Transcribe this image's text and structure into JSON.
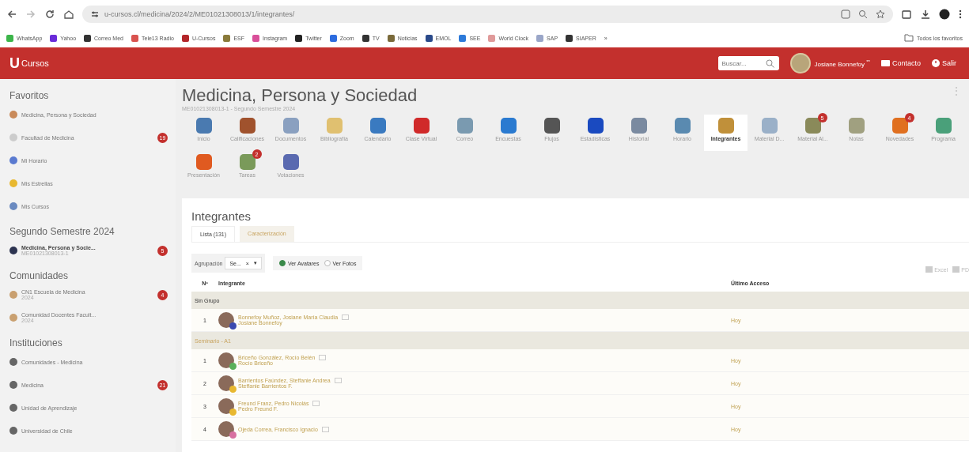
{
  "browser": {
    "url": "u-cursos.cl/medicina/2024/2/ME01021308013/1/integrantes/",
    "bookmarks": [
      {
        "label": "WhatsApp",
        "color": "#3cb54a"
      },
      {
        "label": "Yahoo",
        "color": "#6a2bd9"
      },
      {
        "label": "Correo Med",
        "color": "#333333"
      },
      {
        "label": "Tele13 Radio",
        "color": "#d9534f"
      },
      {
        "label": "U-Cursos",
        "color": "#b3262a"
      },
      {
        "label": "ESF",
        "color": "#8a7a3a"
      },
      {
        "label": "Instagram",
        "color": "#d94f9a"
      },
      {
        "label": "Twitter",
        "color": "#222222"
      },
      {
        "label": "Zoom",
        "color": "#2d6cdf"
      },
      {
        "label": "TV",
        "color": "#333333"
      },
      {
        "label": "Noticias",
        "color": "#7a6a3a"
      },
      {
        "label": "EMOL",
        "color": "#2a4a8a"
      },
      {
        "label": "SEE",
        "color": "#2d7ad9"
      },
      {
        "label": "World Clock",
        "color": "#e09a9a"
      },
      {
        "label": "SAP",
        "color": "#9aa6c8"
      },
      {
        "label": "SIAPER",
        "color": "#333333"
      }
    ],
    "more": "»",
    "all_bookmarks": "Todos los favoritos"
  },
  "header": {
    "logo_letter": "U",
    "logo_text": "Cursos",
    "search_placeholder": "Buscar...",
    "user": "Josiane Bonnefoy",
    "user_mark": "**",
    "contact": "Contacto",
    "logout": "Salir"
  },
  "sidebar": [
    {
      "title": "Favoritos",
      "items": [
        {
          "label": "Medicina, Persona y Sociedad",
          "color": "#c98a5a"
        },
        {
          "label": "Facultad de Medicina",
          "color": "#cccccc",
          "badge": "19"
        },
        {
          "label": "Mi Horario",
          "color": "#5a7ad0"
        },
        {
          "label": "Mis Estrellas",
          "color": "#e8b830"
        },
        {
          "label": "Mis Cursos",
          "color": "#6a8ac0"
        }
      ]
    },
    {
      "title": "Segundo Semestre 2024",
      "items": [
        {
          "label": "Medicina, Persona y Socie...",
          "sub": "ME01021308013-1",
          "color": "#2c3350",
          "badge": "5",
          "bold": true
        }
      ]
    },
    {
      "title": "Comunidades",
      "items": [
        {
          "label": "CN1 Escuela de Medicina",
          "sub": "2024",
          "color": "#c9a070",
          "badge": "4"
        },
        {
          "label": "Comunidad Docentes Facult...",
          "sub": "2024",
          "color": "#c9a070"
        }
      ]
    },
    {
      "title": "Instituciones",
      "items": [
        {
          "label": "Comunidades - Medicina",
          "color": "#666666"
        },
        {
          "label": "Medicina",
          "color": "#666666",
          "badge": "21"
        },
        {
          "label": "Unidad de Aprendizaje",
          "color": "#666666"
        },
        {
          "label": "Universidad de Chile",
          "color": "#666666"
        }
      ]
    }
  ],
  "course": {
    "title": "Medicina, Persona y Sociedad",
    "subtitle": "ME01021308013-1 - Segundo Semestre 2024",
    "menu": "⋮",
    "tools": [
      {
        "label": "Inicio",
        "color": "#4a7ab0",
        "selected": false
      },
      {
        "label": "Calificaciones",
        "color": "#a0522d",
        "selected": false
      },
      {
        "label": "Documentos",
        "color": "#8aa0c0",
        "selected": false
      },
      {
        "label": "Bibliografía",
        "color": "#e0c070",
        "selected": false
      },
      {
        "label": "Calendario",
        "color": "#3a7ac0",
        "selected": false
      },
      {
        "label": "Clase Virtual",
        "color": "#d02a2a",
        "selected": false
      },
      {
        "label": "Correo",
        "color": "#7a9ab0",
        "selected": false
      },
      {
        "label": "Encuestas",
        "color": "#2a7ad0",
        "selected": false
      },
      {
        "label": "Flujos",
        "color": "#555555",
        "selected": false
      },
      {
        "label": "Estadísticas",
        "color": "#1a4ac0",
        "selected": false
      },
      {
        "label": "Historial",
        "color": "#7a8aa0",
        "selected": false
      },
      {
        "label": "Horario",
        "color": "#5a8ab0",
        "selected": false
      },
      {
        "label": "Integrantes",
        "color": "#c0903a",
        "selected": true
      },
      {
        "label": "Material D...",
        "color": "#9ab0c8",
        "selected": false
      },
      {
        "label": "Material Al...",
        "color": "#8a8a5a",
        "selected": false,
        "badge": "5"
      },
      {
        "label": "Notas",
        "color": "#a0a080",
        "selected": false
      },
      {
        "label": "Novedades",
        "color": "#e07020",
        "selected": false,
        "badge": "4"
      },
      {
        "label": "Programa",
        "color": "#4aa07a",
        "selected": false
      },
      {
        "label": "Presentación",
        "color": "#e05a20",
        "selected": false
      },
      {
        "label": "Tareas",
        "color": "#7a9a5a",
        "selected": false,
        "badge": "2"
      },
      {
        "label": "Votaciones",
        "color": "#5a6ab0",
        "selected": false
      }
    ]
  },
  "panel": {
    "title": "Integrantes",
    "tabs": [
      {
        "label": "Lista (131)",
        "selected": true
      },
      {
        "label": "Caracterización",
        "selected": false
      }
    ],
    "grouping_label": "Agrupación",
    "grouping_value": "Se...",
    "clear": "×",
    "caret": "▾",
    "views": [
      {
        "label": "Ver Avatares",
        "selected": true
      },
      {
        "label": "Ver Fotos",
        "selected": false
      }
    ],
    "exports": [
      "Excel",
      "PD"
    ],
    "table": {
      "columns": [
        "Nº",
        "Integrante",
        "Último Acceso"
      ],
      "groups": [
        {
          "name": "Sin Grupo",
          "rows": [
            {
              "n": "1",
              "name": "Bonnefoy Muñoz, Josiane María Claudia",
              "user": "Josiane Bonnefoy",
              "access": "Hoy",
              "color": "#3a4ab0"
            }
          ]
        },
        {
          "name": "Seminario - A1",
          "rows": [
            {
              "n": "1",
              "name": "Briceño González, Rocío Belén",
              "user": "Rocío Briceño",
              "access": "Hoy",
              "color": "#5ab05a"
            },
            {
              "n": "2",
              "name": "Barrientos Faúndez, Steffanie Andrea",
              "user": "Steffanie Barrientos F.",
              "access": "Hoy",
              "color": "#e8b830"
            },
            {
              "n": "3",
              "name": "Freund Franz, Pedro Nicolás",
              "user": "Pedro Freund F.",
              "access": "Hoy",
              "color": "#e8b830"
            },
            {
              "n": "4",
              "name": "Ojeda Correa, Francisco Ignacio",
              "access": "Hoy",
              "color": "#d870a0"
            }
          ]
        }
      ]
    }
  }
}
